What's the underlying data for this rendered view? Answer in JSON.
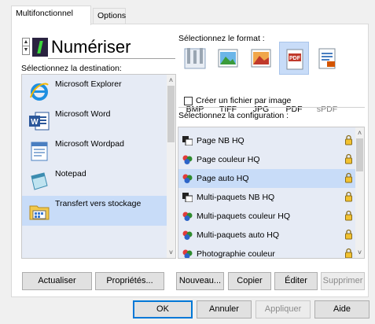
{
  "tabs": [
    {
      "label": "Multifonctionnel",
      "active": true
    },
    {
      "label": "Options",
      "active": false
    }
  ],
  "header": {
    "title": "Numériser",
    "spin_up": "▲",
    "spin_down": "▼"
  },
  "destination": {
    "label": "Sélectionnez la destination:",
    "items": [
      {
        "label": "Microsoft Explorer",
        "icon": "internet-explorer-icon",
        "selected": false
      },
      {
        "label": "Microsoft Word",
        "icon": "word-icon",
        "selected": false
      },
      {
        "label": "Microsoft Wordpad",
        "icon": "wordpad-icon",
        "selected": false
      },
      {
        "label": "Notepad",
        "icon": "notepad-icon",
        "selected": false
      },
      {
        "label": "Transfert vers stockage",
        "icon": "storage-folder-icon",
        "selected": true
      }
    ]
  },
  "format": {
    "label": "Sélectionnez le format :",
    "items": [
      {
        "label": "BMP",
        "selected": false,
        "enabled": true
      },
      {
        "label": "TIFF",
        "selected": false,
        "enabled": true
      },
      {
        "label": "JPG",
        "selected": false,
        "enabled": true
      },
      {
        "label": "PDF",
        "selected": true,
        "enabled": true
      },
      {
        "label": "sPDF",
        "selected": false,
        "enabled": false
      }
    ],
    "one_file_per_image": {
      "label": "Créer un fichier par image",
      "checked": false
    }
  },
  "configuration": {
    "label": "Sélectionnez la configuration :",
    "items": [
      {
        "label": "Page NB HQ",
        "icon": "bw-scan-icon",
        "selected": false
      },
      {
        "label": "Page couleur HQ",
        "icon": "color-scan-icon",
        "selected": false
      },
      {
        "label": "Page auto HQ",
        "icon": "color-scan-icon",
        "selected": true
      },
      {
        "label": "Multi-paquets NB HQ",
        "icon": "bw-scan-icon",
        "selected": false
      },
      {
        "label": "Multi-paquets couleur HQ",
        "icon": "color-scan-icon",
        "selected": false
      },
      {
        "label": "Multi-paquets auto HQ",
        "icon": "color-scan-icon",
        "selected": false
      },
      {
        "label": "Photographie couleur",
        "icon": "color-scan-icon",
        "selected": false
      }
    ]
  },
  "buttons": {
    "refresh": "Actualiser",
    "properties": "Propriétés...",
    "new": "Nouveau...",
    "copy": "Copier",
    "edit": "Éditer",
    "delete": "Supprimer",
    "ok": "OK",
    "cancel": "Annuler",
    "apply": "Appliquer",
    "help": "Aide"
  },
  "colors": {
    "selection": "#c8dcf8",
    "list_background": "#e6ebf5",
    "focus_border": "#0078d7"
  }
}
